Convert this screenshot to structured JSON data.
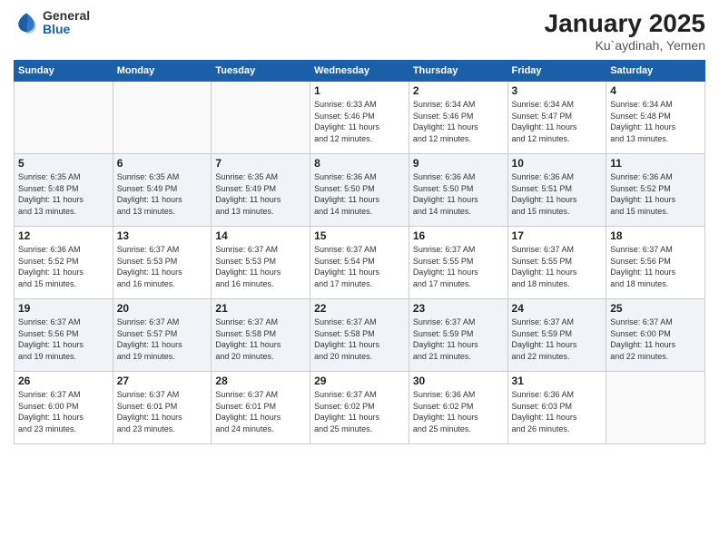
{
  "header": {
    "logo_general": "General",
    "logo_blue": "Blue",
    "month_title": "January 2025",
    "location": "Ku`aydinah, Yemen"
  },
  "weekdays": [
    "Sunday",
    "Monday",
    "Tuesday",
    "Wednesday",
    "Thursday",
    "Friday",
    "Saturday"
  ],
  "weeks": [
    [
      {
        "day": "",
        "info": ""
      },
      {
        "day": "",
        "info": ""
      },
      {
        "day": "",
        "info": ""
      },
      {
        "day": "1",
        "info": "Sunrise: 6:33 AM\nSunset: 5:46 PM\nDaylight: 11 hours\nand 12 minutes."
      },
      {
        "day": "2",
        "info": "Sunrise: 6:34 AM\nSunset: 5:46 PM\nDaylight: 11 hours\nand 12 minutes."
      },
      {
        "day": "3",
        "info": "Sunrise: 6:34 AM\nSunset: 5:47 PM\nDaylight: 11 hours\nand 12 minutes."
      },
      {
        "day": "4",
        "info": "Sunrise: 6:34 AM\nSunset: 5:48 PM\nDaylight: 11 hours\nand 13 minutes."
      }
    ],
    [
      {
        "day": "5",
        "info": "Sunrise: 6:35 AM\nSunset: 5:48 PM\nDaylight: 11 hours\nand 13 minutes."
      },
      {
        "day": "6",
        "info": "Sunrise: 6:35 AM\nSunset: 5:49 PM\nDaylight: 11 hours\nand 13 minutes."
      },
      {
        "day": "7",
        "info": "Sunrise: 6:35 AM\nSunset: 5:49 PM\nDaylight: 11 hours\nand 13 minutes."
      },
      {
        "day": "8",
        "info": "Sunrise: 6:36 AM\nSunset: 5:50 PM\nDaylight: 11 hours\nand 14 minutes."
      },
      {
        "day": "9",
        "info": "Sunrise: 6:36 AM\nSunset: 5:50 PM\nDaylight: 11 hours\nand 14 minutes."
      },
      {
        "day": "10",
        "info": "Sunrise: 6:36 AM\nSunset: 5:51 PM\nDaylight: 11 hours\nand 15 minutes."
      },
      {
        "day": "11",
        "info": "Sunrise: 6:36 AM\nSunset: 5:52 PM\nDaylight: 11 hours\nand 15 minutes."
      }
    ],
    [
      {
        "day": "12",
        "info": "Sunrise: 6:36 AM\nSunset: 5:52 PM\nDaylight: 11 hours\nand 15 minutes."
      },
      {
        "day": "13",
        "info": "Sunrise: 6:37 AM\nSunset: 5:53 PM\nDaylight: 11 hours\nand 16 minutes."
      },
      {
        "day": "14",
        "info": "Sunrise: 6:37 AM\nSunset: 5:53 PM\nDaylight: 11 hours\nand 16 minutes."
      },
      {
        "day": "15",
        "info": "Sunrise: 6:37 AM\nSunset: 5:54 PM\nDaylight: 11 hours\nand 17 minutes."
      },
      {
        "day": "16",
        "info": "Sunrise: 6:37 AM\nSunset: 5:55 PM\nDaylight: 11 hours\nand 17 minutes."
      },
      {
        "day": "17",
        "info": "Sunrise: 6:37 AM\nSunset: 5:55 PM\nDaylight: 11 hours\nand 18 minutes."
      },
      {
        "day": "18",
        "info": "Sunrise: 6:37 AM\nSunset: 5:56 PM\nDaylight: 11 hours\nand 18 minutes."
      }
    ],
    [
      {
        "day": "19",
        "info": "Sunrise: 6:37 AM\nSunset: 5:56 PM\nDaylight: 11 hours\nand 19 minutes."
      },
      {
        "day": "20",
        "info": "Sunrise: 6:37 AM\nSunset: 5:57 PM\nDaylight: 11 hours\nand 19 minutes."
      },
      {
        "day": "21",
        "info": "Sunrise: 6:37 AM\nSunset: 5:58 PM\nDaylight: 11 hours\nand 20 minutes."
      },
      {
        "day": "22",
        "info": "Sunrise: 6:37 AM\nSunset: 5:58 PM\nDaylight: 11 hours\nand 20 minutes."
      },
      {
        "day": "23",
        "info": "Sunrise: 6:37 AM\nSunset: 5:59 PM\nDaylight: 11 hours\nand 21 minutes."
      },
      {
        "day": "24",
        "info": "Sunrise: 6:37 AM\nSunset: 5:59 PM\nDaylight: 11 hours\nand 22 minutes."
      },
      {
        "day": "25",
        "info": "Sunrise: 6:37 AM\nSunset: 6:00 PM\nDaylight: 11 hours\nand 22 minutes."
      }
    ],
    [
      {
        "day": "26",
        "info": "Sunrise: 6:37 AM\nSunset: 6:00 PM\nDaylight: 11 hours\nand 23 minutes."
      },
      {
        "day": "27",
        "info": "Sunrise: 6:37 AM\nSunset: 6:01 PM\nDaylight: 11 hours\nand 23 minutes."
      },
      {
        "day": "28",
        "info": "Sunrise: 6:37 AM\nSunset: 6:01 PM\nDaylight: 11 hours\nand 24 minutes."
      },
      {
        "day": "29",
        "info": "Sunrise: 6:37 AM\nSunset: 6:02 PM\nDaylight: 11 hours\nand 25 minutes."
      },
      {
        "day": "30",
        "info": "Sunrise: 6:36 AM\nSunset: 6:02 PM\nDaylight: 11 hours\nand 25 minutes."
      },
      {
        "day": "31",
        "info": "Sunrise: 6:36 AM\nSunset: 6:03 PM\nDaylight: 11 hours\nand 26 minutes."
      },
      {
        "day": "",
        "info": ""
      }
    ]
  ]
}
